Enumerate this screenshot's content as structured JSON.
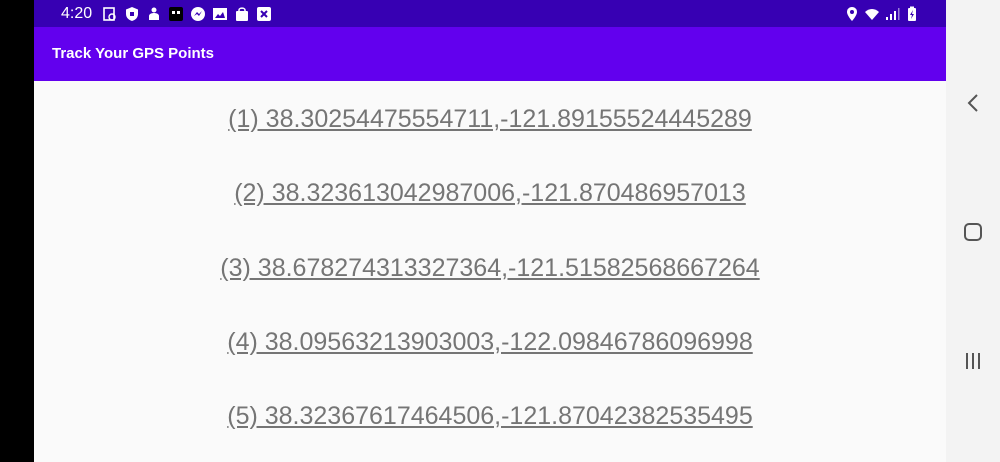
{
  "status_bar": {
    "time": "4:20",
    "background": "#3700b3",
    "left_icons": [
      "screenshot-icon",
      "shield-icon",
      "android-icon",
      "app-icon",
      "messenger-icon",
      "image-icon",
      "shopping-bag-icon",
      "close-box-icon"
    ],
    "right_icons": [
      "location-icon",
      "wifi-icon",
      "signal-icon",
      "battery-icon"
    ]
  },
  "app_bar": {
    "title": "Track Your GPS Points",
    "background": "#6200ee"
  },
  "points": [
    {
      "label": "(1) 38.30254475554711,-121.89155524445289"
    },
    {
      "label": "(2) 38.323613042987006,-121.870486957013"
    },
    {
      "label": "(3) 38.678274313327364,-121.51582568667264"
    },
    {
      "label": "(4) 38.09563213903003,-122.09846786096998"
    },
    {
      "label": "(5) 38.32367617464506,-121.87042382535495"
    }
  ],
  "navigation_bar": {
    "buttons": [
      "back-icon",
      "home-icon",
      "recents-icon"
    ]
  },
  "colors": {
    "link_text": "#757575",
    "content_background": "#fafafa"
  }
}
